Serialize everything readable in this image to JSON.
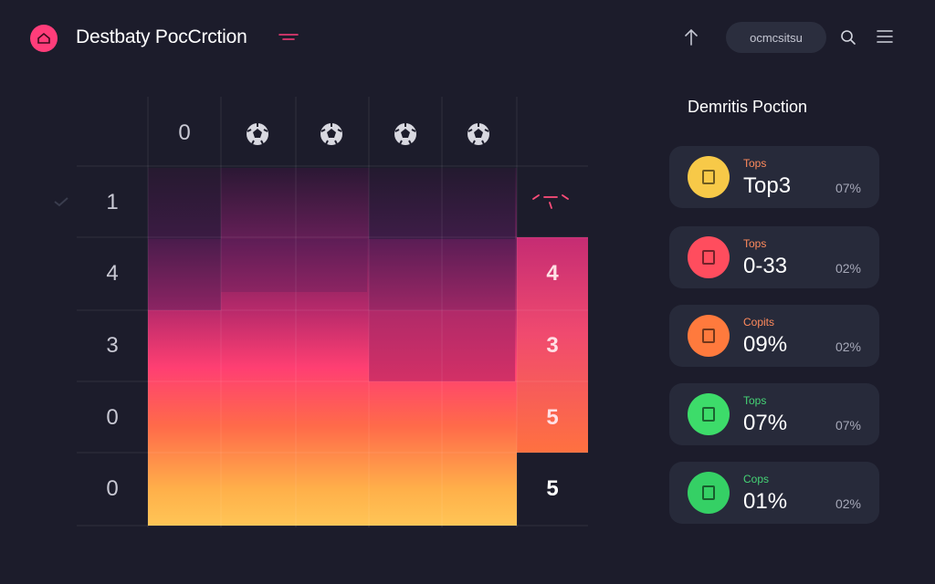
{
  "header": {
    "title": "Destbaty PocCrction",
    "search_label": "ocmcsitsu",
    "icons": [
      "app-logo-icon",
      "upload-icon",
      "search-icon",
      "menu-icon"
    ],
    "accent": "#ff3d7a"
  },
  "grid": {
    "column_headers": [
      "0",
      "ball",
      "ball",
      "ball",
      "ball"
    ],
    "first_column_header": "0",
    "row_labels": [
      "1",
      "4",
      "3",
      "0",
      "0"
    ],
    "right_values": [
      "4",
      "3",
      "5",
      "5"
    ],
    "colors": {
      "top": "#2b1834",
      "mid": "#ff3f72",
      "bottom": "#ffc556"
    }
  },
  "panel": {
    "title": "Demritis Poction",
    "cards": [
      {
        "label": "Tops",
        "value": "Top3",
        "pct": "07%",
        "color": "#f7c948",
        "label_color": "#ff8a5c"
      },
      {
        "label": "Tops",
        "value": "0-33",
        "pct": "02%",
        "color": "#ff4d5e",
        "label_color": "#ff8a5c"
      },
      {
        "label": "Copits",
        "value": "09%",
        "pct": "02%",
        "color": "#ff7a3d",
        "label_color": "#ff8a5c"
      },
      {
        "label": "Tops",
        "value": "07%",
        "pct": "07%",
        "color": "#3ddc6a",
        "label_color": "#45d475"
      },
      {
        "label": "Cops",
        "value": "01%",
        "pct": "02%",
        "color": "#35d065",
        "label_color": "#45d475"
      }
    ]
  }
}
